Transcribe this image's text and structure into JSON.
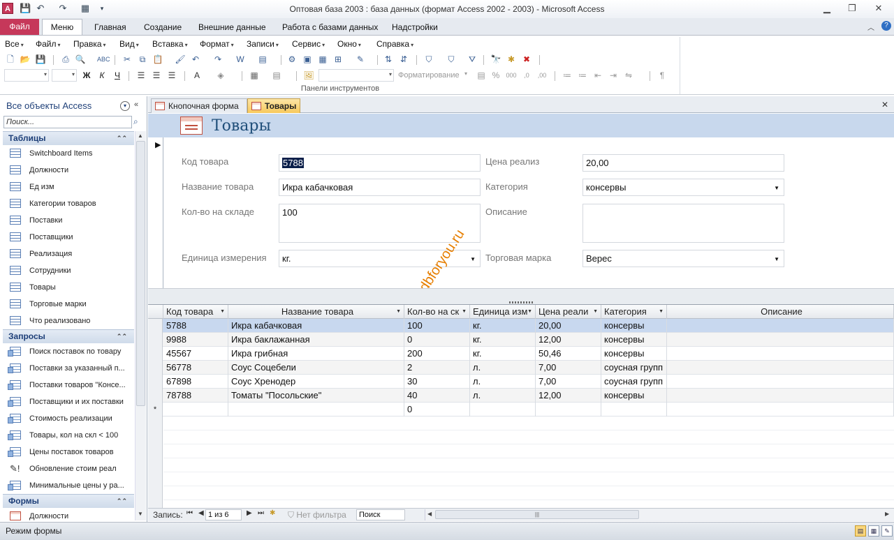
{
  "window": {
    "title": "Оптовая база 2003 : база данных (формат Access 2002 - 2003)  -  Microsoft Access",
    "app_icon": "A",
    "minimize_glyph": "▁",
    "restore_glyph": "❐",
    "close_glyph": "✕"
  },
  "ribbon_tabs": [
    "Файл",
    "Меню",
    "Главная",
    "Создание",
    "Внешние данные",
    "Работа с базами данных",
    "Надстройки"
  ],
  "active_tab": "Меню",
  "ribbon": {
    "menus": [
      "Все",
      "Файл",
      "Правка",
      "Вид",
      "Вставка",
      "Формат",
      "Записи",
      "Сервис",
      "Окно",
      "Справка"
    ],
    "format_combo": "Форматирование",
    "group_label": "Панели инструментов"
  },
  "nav": {
    "title": "Все объекты Access",
    "search_placeholder": "Поиск...",
    "groups": [
      {
        "name": "Таблицы",
        "type": "table",
        "items": [
          "Switchboard Items",
          "Должности",
          "Ед изм",
          "Категории товаров",
          "Поставки",
          "Поставщики",
          "Реализация",
          "Сотрудники",
          "Товары",
          "Торговые марки",
          "Что реализовано"
        ]
      },
      {
        "name": "Запросы",
        "type": "query",
        "items": [
          "Поиск поставок по товару",
          "Поставки за указанный п...",
          "Поставки товаров \"Консе...",
          "Поставщики и их поставки",
          "Стоимость реализации",
          "Товары, кол на скл < 100",
          "Цены поставок товаров",
          "Обновление стоим реал",
          "Минимальные цены у ра..."
        ]
      },
      {
        "name": "Формы",
        "type": "form",
        "items": [
          "Должности"
        ]
      }
    ]
  },
  "doc_tabs": [
    "Кнопочная форма",
    "Товары"
  ],
  "form": {
    "title": "Товары",
    "fields": {
      "code": {
        "label": "Код товара",
        "value": "5788"
      },
      "name": {
        "label": "Название товара",
        "value": "Икра кабачковая"
      },
      "qty": {
        "label": "Кол-во на складе",
        "value": "100"
      },
      "unit": {
        "label": "Единица измерения",
        "value": "кг."
      },
      "price": {
        "label": "Цена реализ",
        "value": "20,00"
      },
      "category": {
        "label": "Категория",
        "value": "консервы"
      },
      "description": {
        "label": "Описание",
        "value": ""
      },
      "brand": {
        "label": "Торговая марка",
        "value": "Верес"
      }
    },
    "watermark": "dbforyou.ru"
  },
  "datasheet": {
    "columns": [
      "Код товара",
      "Название товара",
      "Кол-во на ск",
      "Единица изм",
      "Цена реали",
      "Категория",
      "Описание"
    ],
    "rows": [
      [
        "5788",
        "Икра кабачковая",
        "100",
        "кг.",
        "20,00",
        "консервы",
        ""
      ],
      [
        "9988",
        "Икра баклажанная",
        "0",
        "кг.",
        "12,00",
        "консервы",
        ""
      ],
      [
        "45567",
        "Икра грибная",
        "200",
        "кг.",
        "50,46",
        "консервы",
        ""
      ],
      [
        "56778",
        "Соус Соцебели",
        "2",
        "л.",
        "7,00",
        "соусная групп",
        ""
      ],
      [
        "67898",
        "Соус Хренодер",
        "30",
        "л.",
        "7,00",
        "соусная групп",
        ""
      ],
      [
        "78788",
        "Томаты \"Посольские\"",
        "40",
        "л.",
        "12,00",
        "консервы",
        ""
      ]
    ],
    "new_row": [
      "",
      "",
      "0",
      "",
      "",
      "",
      ""
    ],
    "new_row_marker": "*",
    "current_marker": "▶"
  },
  "record_nav": {
    "label": "Запись:",
    "position": "1 из 6",
    "filter": "Нет фильтра",
    "search": "Поиск"
  },
  "status": {
    "text": "Режим формы"
  }
}
